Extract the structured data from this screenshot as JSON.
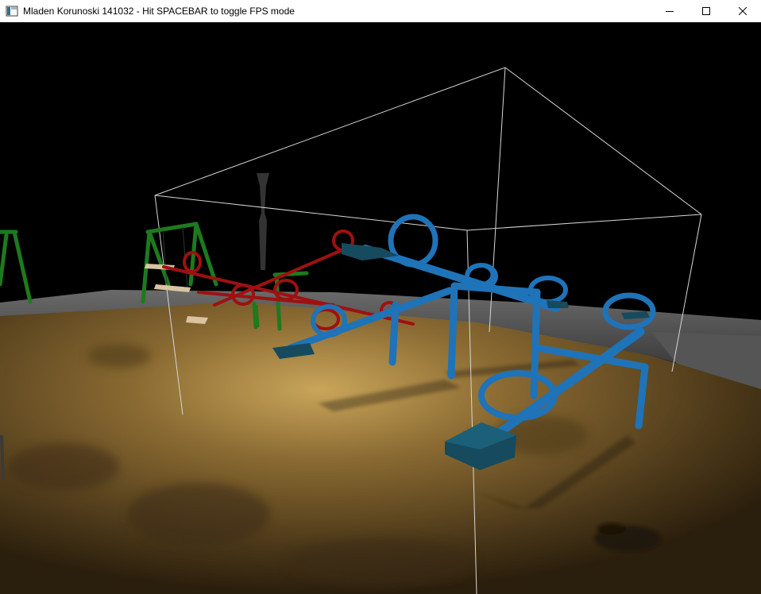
{
  "window": {
    "title": "Mladen Korunoski 141032 - Hit SPACEBAR to toggle FPS mode",
    "icon": "app-window-icon",
    "controls": [
      "minimize-icon",
      "maximize-icon",
      "close-icon"
    ]
  },
  "scene": {
    "background_color": "#000000",
    "ground_color": "#7a5f2e",
    "pavement_color": "#5a5a5a",
    "colors": {
      "bounding_box": "#d8d8d8",
      "blue_seesaws": "#1f73b8",
      "red_seesaw": "#a01010",
      "swing_frame": "#1d7a1d",
      "lamp_post": "#333333",
      "seat_dark": "#164a5e"
    }
  }
}
